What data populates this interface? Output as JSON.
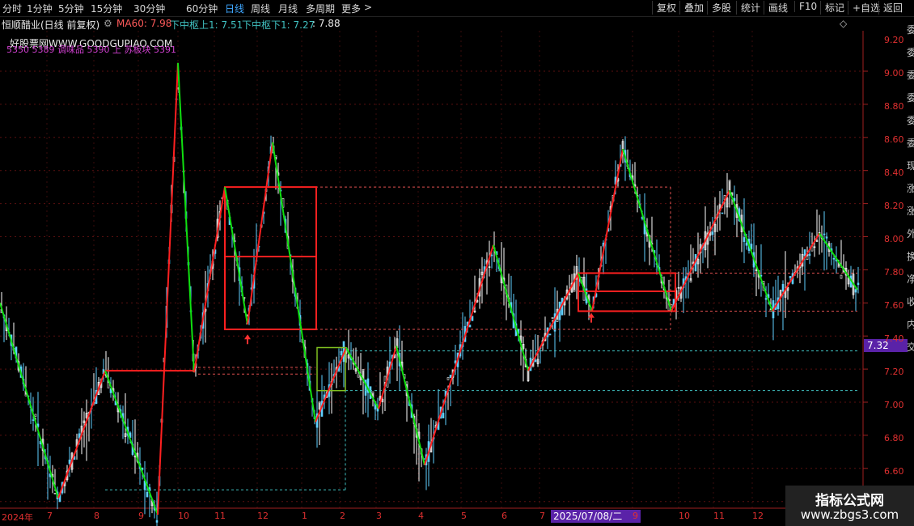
{
  "toolbar": {
    "periods": [
      "分时",
      "1分钟",
      "5分钟",
      "15分钟",
      "30分钟",
      "60分钟",
      "日线",
      "周线",
      "月线",
      "多周期",
      "更多"
    ],
    "active": "日线",
    "more_arrow": ">",
    "right_buttons": [
      "复权",
      "叠加",
      "多股",
      "统计",
      "画线",
      "F10",
      "标记",
      "+自选",
      "返回"
    ]
  },
  "info": {
    "title": "恒顺醋业(日线 前复权)",
    "ma": "MA60: 7.98",
    "upper": "下中枢上1: 7.51",
    "lower": "下中枢下1: 7.27",
    "last": ": 7.88",
    "diamond": "◇",
    "settings_icon": "⚙"
  },
  "watermark": {
    "site_cn": "好股票网",
    "site": "WWW.GOODGUPIAO.COM",
    "codes": "5350 5389 调味品 5390 上 苏板块 5391"
  },
  "price_axis": {
    "labels": [
      "9.20",
      "9.00",
      "8.80",
      "8.60",
      "8.40",
      "8.20",
      "8.00",
      "7.80",
      "7.60",
      "7.40",
      "7.20",
      "7.00",
      "6.80",
      "6.60"
    ],
    "current_price": "7.32"
  },
  "time_axis": {
    "year_label": "2024年",
    "months": [
      "7",
      "8",
      "9",
      "10",
      "11",
      "12",
      "1",
      "2",
      "3",
      "4",
      "5",
      "6",
      "7",
      "9",
      "10",
      "11",
      "12"
    ],
    "cursor_date": "2025/07/08/二"
  },
  "side_glyphs": [
    "委",
    "委",
    "委",
    "委",
    "委",
    "委",
    "现",
    "涨",
    "涨",
    "外",
    "换",
    "净",
    "收",
    "内",
    "交"
  ],
  "site_badge": {
    "cn": "指标公式网",
    "url": "www.zbgs3.com"
  },
  "colors": {
    "up": "#ff3030",
    "down": "#00e000",
    "accent": "#3fa7ff",
    "cyan": "#40c0c0",
    "magenta": "#e040e0",
    "axis": "#e03030",
    "marker": "#5a22a8"
  },
  "chart_data": {
    "type": "line",
    "series": [
      {
        "values": [
          {
            "x": 0,
            "y": 7.8
          },
          {
            "x": 72,
            "y": 6.62
          },
          {
            "x": 130,
            "y": 7.39
          },
          {
            "x": 195,
            "y": 6.52
          },
          {
            "x": 220,
            "y": 9.25
          },
          {
            "x": 240,
            "y": 7.38
          },
          {
            "x": 278,
            "y": 8.5
          },
          {
            "x": 306,
            "y": 7.67
          },
          {
            "x": 337,
            "y": 8.77
          },
          {
            "x": 390,
            "y": 7.08
          },
          {
            "x": 428,
            "y": 7.53
          },
          {
            "x": 468,
            "y": 7.16
          },
          {
            "x": 490,
            "y": 7.54
          },
          {
            "x": 525,
            "y": 6.82
          },
          {
            "x": 610,
            "y": 8.15
          },
          {
            "x": 653,
            "y": 7.39
          },
          {
            "x": 715,
            "y": 7.98
          },
          {
            "x": 732,
            "y": 7.75
          },
          {
            "x": 770,
            "y": 8.73
          },
          {
            "x": 830,
            "y": 7.75
          },
          {
            "x": 902,
            "y": 8.48
          },
          {
            "x": 955,
            "y": 7.75
          },
          {
            "x": 1013,
            "y": 8.22
          },
          {
            "x": 1060,
            "y": 7.88
          }
        ]
      }
    ],
    "ylim": [
      6.5,
      9.3
    ]
  }
}
